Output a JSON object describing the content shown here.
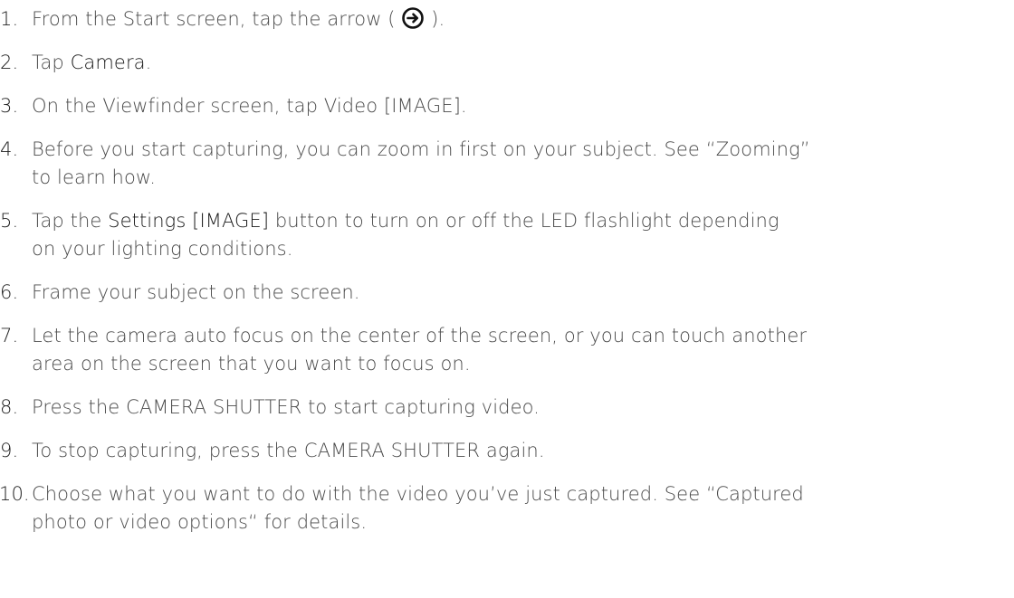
{
  "steps": [
    {
      "num": "1.",
      "pre": "From the Start screen, tap the arrow (",
      "post": ")."
    },
    {
      "num": "2.",
      "pre": "Tap ",
      "em": "Camera",
      "post": "."
    },
    {
      "num": "3.",
      "text": "On the Viewfinder screen, tap Video [IMAGE]."
    },
    {
      "num": "4.",
      "line1": "Before you start capturing, you can zoom in first on your subject. See “Zooming”",
      "line2": "to learn how."
    },
    {
      "num": "5.",
      "pre": "Tap the ",
      "em": "Settings [IMAGE]",
      "post": " button to turn on or off the LED flashlight depending",
      "line2": "on your lighting conditions."
    },
    {
      "num": "6.",
      "text": "Frame your subject on the screen."
    },
    {
      "num": "7.",
      "line1": "Let the camera auto focus on the center of the screen, or you can touch another",
      "line2": "area on the screen that you want to focus on."
    },
    {
      "num": "8.",
      "text": "Press the CAMERA SHUTTER to start capturing video."
    },
    {
      "num": "9.",
      "text": "To stop capturing, press the CAMERA SHUTTER again."
    },
    {
      "num": "10.",
      "line1": "Choose what you want to do with the video you’ve just captured. See “Captured",
      "line2": "photo or video options“ for details."
    }
  ],
  "icons": {
    "arrow": "arrow-right-circle-icon"
  },
  "colors": {
    "text": "#4a4a4a",
    "number": "#222222"
  }
}
